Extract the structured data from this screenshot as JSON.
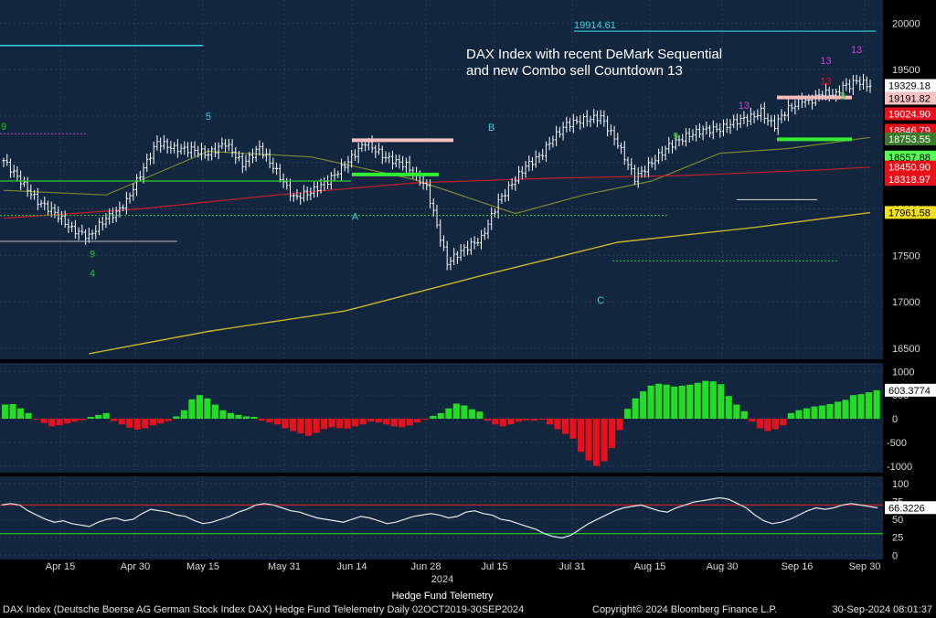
{
  "chart_data": [
    {
      "type": "candlestick",
      "panel": "price",
      "annotation_lines": [
        "DAX Index with recent DeMark Sequential",
        "and new Combo sell Countdown 13"
      ],
      "yticks": [
        16500,
        17000,
        17500,
        18000,
        18500,
        19000,
        19500,
        20000
      ],
      "ylim": [
        16380,
        20250
      ],
      "peak_label": "19914.61",
      "price_labels": [
        {
          "text": "19329.18",
          "bg": "#ffffff",
          "fg": "#000000",
          "value": 19329.18
        },
        {
          "text": "19191.82",
          "bg": "#f4c2c2",
          "fg": "#000000",
          "value": 19191.82
        },
        {
          "text": "19024.90",
          "bg": "#e8101a",
          "fg": "#ffffff",
          "value": 19024.9
        },
        {
          "text": "18846.79",
          "bg": "#e8101a",
          "fg": "#ffffff",
          "value": 18846.79
        },
        {
          "text": "18753.55",
          "bg": "#3a7a2a",
          "fg": "#ffffff",
          "value": 18753.55
        },
        {
          "text": "18557.88",
          "bg": "#55ff55",
          "fg": "#000000",
          "value": 18557.88
        },
        {
          "text": "18450.90",
          "bg": "#e8101a",
          "fg": "#ffffff",
          "value": 18450.9
        },
        {
          "text": "18318.97",
          "bg": "#e8101a",
          "fg": "#ffffff",
          "value": 18318.97
        },
        {
          "text": "17961.58",
          "bg": "#f0e020",
          "fg": "#000000",
          "value": 17961.58
        }
      ],
      "series": [
        {
          "name": "Close",
          "x": [
            0,
            5,
            10,
            15,
            20,
            25,
            30,
            33,
            36,
            40,
            45,
            50,
            55,
            60,
            65,
            70,
            75,
            80,
            85,
            90,
            95,
            100,
            106,
            112,
            118,
            124,
            130,
            135,
            140,
            145,
            150,
            153,
            156,
            158,
            160,
            165,
            170,
            175,
            180,
            185,
            190,
            195,
            200,
            205,
            210,
            215,
            220,
            222,
            224,
            226,
            228,
            230,
            232,
            234,
            236,
            238,
            240,
            242,
            244,
            245,
            246,
            248,
            250,
            252,
            254
          ],
          "values": [
            18520,
            18300,
            18080,
            17960,
            17780,
            17700,
            17900,
            17960,
            18080,
            18370,
            18720,
            18650,
            18640,
            18590,
            18710,
            18480,
            18660,
            18400,
            18120,
            18180,
            18300,
            18470,
            18720,
            18550,
            18470,
            18230,
            17420,
            17570,
            17680,
            18080,
            18320,
            18460,
            18540,
            18600,
            18720,
            18910,
            18960,
            18990,
            18700,
            18330,
            18500,
            18680,
            18780,
            18850,
            18860,
            18950,
            19000,
            19050,
            18950,
            18900,
            19000,
            19080,
            19120,
            19180,
            19150,
            19200,
            19250,
            19240,
            19230,
            19280,
            19320,
            19330,
            19380,
            19350,
            19329
          ]
        },
        {
          "name": "MA1",
          "x": [
            0,
            40,
            80,
            120,
            160,
            200,
            240,
            254
          ],
          "values": [
            17900,
            18000,
            18150,
            18280,
            18330,
            18360,
            18420,
            18450
          ]
        },
        {
          "name": "MA2",
          "x": [
            0,
            30,
            60,
            90,
            120,
            150,
            170,
            190,
            210,
            230,
            254
          ],
          "values": [
            18200,
            18150,
            18620,
            18560,
            18320,
            17950,
            18150,
            18300,
            18600,
            18650,
            18770
          ]
        },
        {
          "name": "MA3",
          "x": [
            25,
            60,
            100,
            140,
            180,
            220,
            254
          ],
          "values": [
            16440,
            16680,
            16900,
            17280,
            17640,
            17800,
            17960
          ]
        }
      ],
      "demark_markers": [
        {
          "text": "9",
          "xi": 0,
          "v": 18850,
          "color": "#22cc22"
        },
        {
          "text": "9",
          "xi": 26,
          "v": 17480,
          "color": "#22cc22"
        },
        {
          "text": "4",
          "xi": 26,
          "v": 17270,
          "color": "#22cc22"
        },
        {
          "text": "9",
          "xi": 197,
          "v": 18750,
          "color": "#22cc22"
        },
        {
          "text": "13",
          "xi": 217,
          "v": 19080,
          "color": "#cc44cc"
        },
        {
          "text": "13",
          "xi": 241,
          "v": 19560,
          "color": "#cc44cc"
        },
        {
          "text": "13",
          "xi": 250,
          "v": 19680,
          "color": "#cc44cc"
        },
        {
          "text": "13",
          "xi": 241,
          "v": 19340,
          "color": "#e8101a"
        },
        {
          "text": "9",
          "xi": 246,
          "v": 19180,
          "color": "#22cc22"
        },
        {
          "text": "A",
          "xi": 103,
          "v": 17880,
          "color": "#33d6e0"
        },
        {
          "text": "B",
          "xi": 143,
          "v": 18840,
          "color": "#33d6e0"
        },
        {
          "text": "C",
          "xi": 175,
          "v": 16980,
          "color": "#33d6e0"
        },
        {
          "text": "5",
          "xi": 60,
          "v": 18960,
          "color": "#33d6e0"
        }
      ]
    },
    {
      "type": "bar",
      "panel": "oscillator",
      "label": "603.3774",
      "yticks": [
        1000,
        500,
        0,
        -500,
        -1000
      ],
      "ylim": [
        -1140,
        1180
      ],
      "values": [
        300,
        310,
        220,
        120,
        -20,
        -90,
        -160,
        -140,
        -100,
        -60,
        -30,
        40,
        80,
        120,
        -50,
        -120,
        -190,
        -230,
        -200,
        -140,
        -100,
        -50,
        50,
        180,
        410,
        500,
        430,
        300,
        180,
        120,
        80,
        50,
        40,
        -40,
        -80,
        -120,
        -200,
        -260,
        -310,
        -360,
        -300,
        -220,
        -180,
        -200,
        -210,
        -160,
        -120,
        -60,
        -80,
        -120,
        -160,
        -180,
        -140,
        -80,
        -20,
        60,
        120,
        220,
        320,
        280,
        200,
        150,
        -40,
        -120,
        -160,
        -120,
        -60,
        -30,
        -40,
        -20,
        -120,
        -220,
        -320,
        -420,
        -700,
        -880,
        -1000,
        -900,
        -620,
        -240,
        210,
        430,
        580,
        700,
        740,
        720,
        680,
        700,
        720,
        760,
        800,
        790,
        730,
        480,
        300,
        160,
        -60,
        -200,
        -260,
        -220,
        -140,
        120,
        180,
        220,
        260,
        280,
        310,
        360,
        400,
        500,
        520,
        560,
        603
      ]
    },
    {
      "type": "line",
      "panel": "rsi",
      "label": "66.3226",
      "yticks": [
        100,
        75,
        50,
        25,
        0
      ],
      "ylim": [
        -6,
        110
      ],
      "overbought": 70,
      "oversold": 30,
      "values": [
        70,
        72,
        70,
        62,
        56,
        50,
        46,
        48,
        44,
        42,
        40,
        46,
        50,
        52,
        48,
        50,
        58,
        64,
        62,
        60,
        56,
        54,
        48,
        44,
        46,
        50,
        54,
        60,
        64,
        70,
        72,
        70,
        66,
        62,
        60,
        56,
        52,
        50,
        48,
        46,
        50,
        54,
        52,
        48,
        44,
        46,
        50,
        54,
        56,
        58,
        56,
        52,
        54,
        60,
        62,
        58,
        56,
        50,
        48,
        44,
        40,
        36,
        30,
        26,
        24,
        28,
        36,
        44,
        50,
        56,
        62,
        66,
        68,
        70,
        66,
        62,
        60,
        66,
        70,
        74,
        76,
        78,
        80,
        78,
        72,
        66,
        56,
        48,
        44,
        46,
        50,
        56,
        62,
        66,
        64,
        66,
        70,
        72,
        70,
        68,
        66
      ]
    }
  ],
  "xaxis": {
    "labels": [
      "Apr 15",
      "Apr 30",
      "May 15",
      "May 31",
      "Jun 14",
      "Jun 28",
      "Jul 15",
      "Jul 31",
      "Aug 15",
      "Aug 30",
      "Sep 16",
      "Sep 30"
    ],
    "year": "2024"
  },
  "title_bottom": "Hedge Fund Telemetry",
  "footer": {
    "left": "DAX Index (Deutsche Boerse AG German Stock Index DAX) Hedge Fund Telelemetry  Daily 02OCT2019-30SEP2024",
    "mid": "Copyright© 2024 Bloomberg Finance L.P.",
    "right": "30-Sep-2024 08:01:37"
  },
  "colors": {
    "panel_bg": "#132640",
    "candle": "#ffffff",
    "ma1": "#c41e2a",
    "ma2": "#7a8a2a",
    "ma3": "#c8b428",
    "hist_pos": "#22dd22",
    "hist_neg": "#e8101a",
    "rsi_line": "#e8e8e8",
    "ob_line": "#c41e2a",
    "os_line": "#22cc22",
    "resistance": "#f7bcbc",
    "support": "#33ee33",
    "cyan": "#33d6e0",
    "magenta": "#cc33cc"
  }
}
